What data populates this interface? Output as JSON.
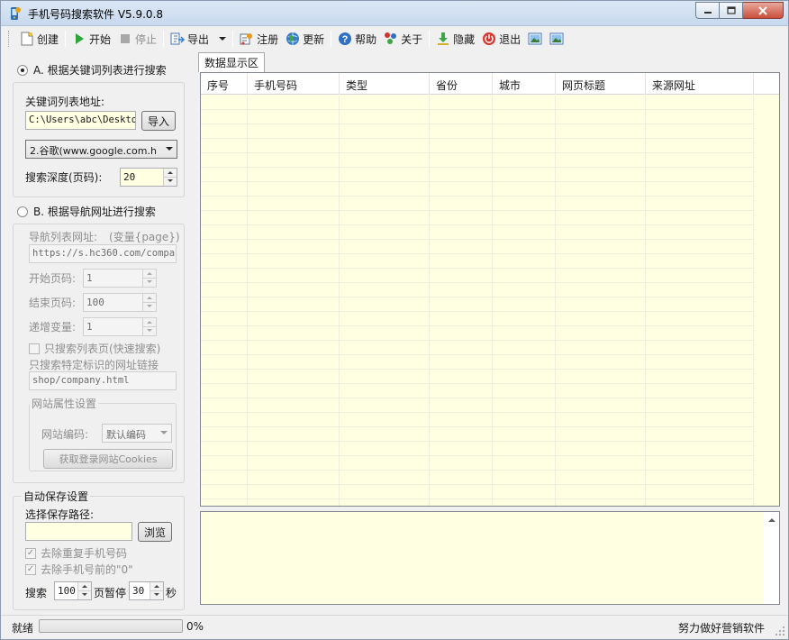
{
  "window": {
    "title": "手机号码搜索软件 V5.9.0.8"
  },
  "toolbar": {
    "create": "创建",
    "start": "开始",
    "stop": "停止",
    "export": "导出",
    "register": "注册",
    "update": "更新",
    "help": "帮助",
    "about": "关于",
    "hide": "隐藏",
    "exit": "退出"
  },
  "mode_a": {
    "label": "A. 根据关键词列表进行搜索",
    "selected": true,
    "keyword_list_label": "关键词列表地址:",
    "keyword_list_path": "C:\\Users\\abc\\Deskto",
    "import_button": "导入",
    "engine": "2.谷歌(www.google.com.h",
    "depth_label": "搜索深度(页码):",
    "depth_value": "20"
  },
  "mode_b": {
    "label": "B. 根据导航网址进行搜索",
    "selected": false,
    "nav_url_label": "导航列表网址:",
    "nav_url_hint": "(变量{page})",
    "nav_url_value": "https://s.hc360.com/compan",
    "start_page_label": "开始页码:",
    "start_page_value": "1",
    "end_page_label": "结束页码:",
    "end_page_value": "100",
    "step_label": "递增变量:",
    "step_value": "1",
    "list_only_label": "只搜索列表页(快速搜索)",
    "specific_link_label": "只搜索特定标识的网址链接",
    "specific_link_value": "shop/company.html",
    "site_settings_title": "网站属性设置",
    "encoding_label": "网站编码:",
    "encoding_value": "默认编码",
    "cookies_button": "获取登录网站Cookies"
  },
  "autosave": {
    "title": "自动保存设置",
    "path_label": "选择保存路径:",
    "path_value": "",
    "browse_button": "浏览",
    "dedupe_label": "去除重复手机号码",
    "strip_zero_label": "去除手机号前的\"0\"",
    "search_label": "搜索",
    "search_pages": "100",
    "pause_label": "页暂停",
    "pause_seconds": "30",
    "seconds_label": "秒"
  },
  "data_area": {
    "tab_label": "数据显示区",
    "columns": [
      "序号",
      "手机号码",
      "类型",
      "省份",
      "城市",
      "网页标题",
      "来源网址"
    ]
  },
  "status": {
    "ready": "就绪",
    "progress_percent": 0,
    "progress_text": "0%",
    "slogan": "努力做好营销软件"
  }
}
